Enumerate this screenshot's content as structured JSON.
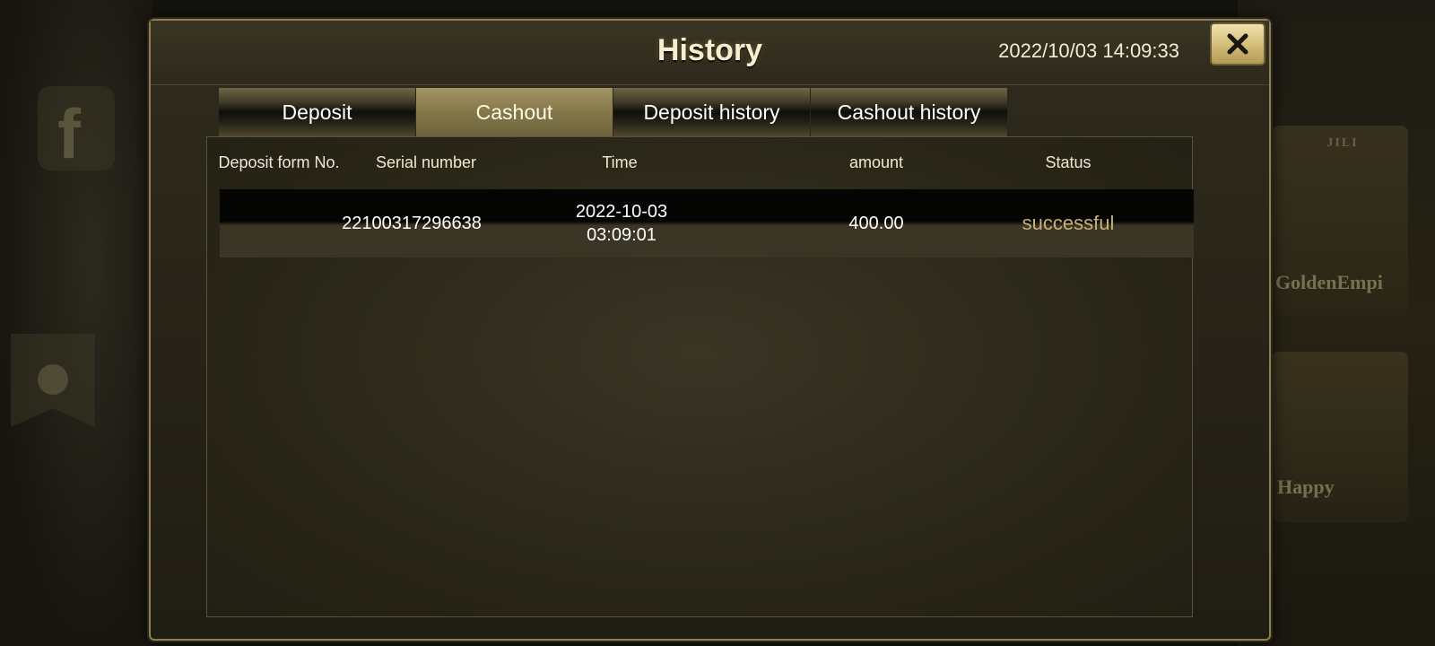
{
  "background": {
    "facebook_icon": "facebook-icon",
    "games": [
      "GoldenEmpi",
      "Happy"
    ],
    "badge": "JILI"
  },
  "dialog": {
    "title": "History",
    "clock": "2022/10/03 14:09:33",
    "close_icon": "close-icon"
  },
  "tabs": [
    {
      "label": "Deposit",
      "active": false
    },
    {
      "label": "Cashout",
      "active": true
    },
    {
      "label": "Deposit history",
      "active": false
    },
    {
      "label": "Cashout history",
      "active": false
    }
  ],
  "table": {
    "columns": [
      "Deposit form No.",
      "Serial number",
      "Time",
      "amount",
      "Status"
    ],
    "rows": [
      {
        "deposit_form_no": "",
        "serial_number": "22100317296638",
        "time_date": "2022-10-03",
        "time_clock": "03:09:01",
        "amount": "400.00",
        "status": "successful"
      }
    ]
  },
  "colors": {
    "accent_gold": "#d7c27f",
    "status_text": "#c7b179",
    "panel_bg": "#2b2819"
  }
}
